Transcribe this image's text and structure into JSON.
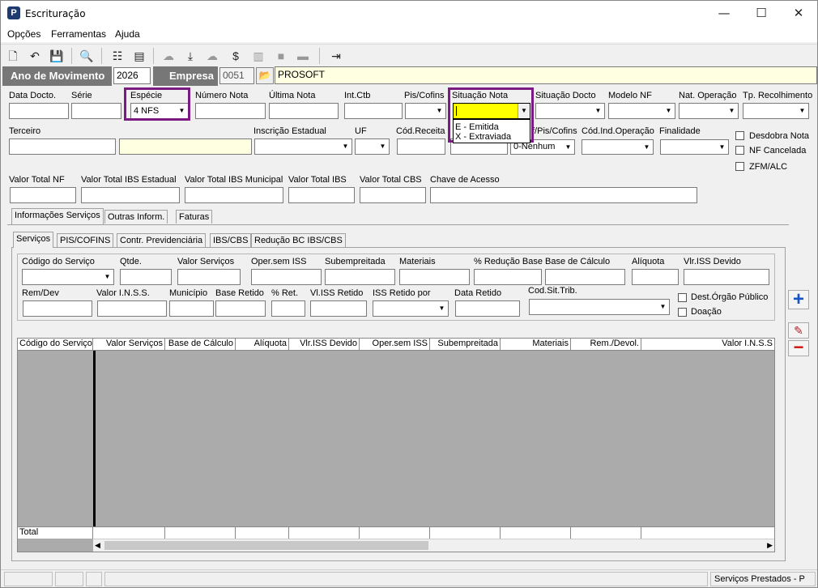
{
  "window": {
    "title": "Escrituração",
    "min": "—",
    "max": "☐",
    "close": "✕"
  },
  "menu": [
    "Opções",
    "Ferramentas",
    "Ajuda"
  ],
  "header": {
    "ano_label": "Ano de Movimento",
    "ano_value": "2026",
    "empresa_label": "Empresa",
    "empresa_code": "0051",
    "empresa_name": "PROSOFT"
  },
  "labels": {
    "data_docto": "Data Docto.",
    "serie": "Série",
    "especie": "Espécie",
    "numero_nota": "Número Nota",
    "ultima_nota": "Última Nota",
    "int_ctb": "Int.Ctb",
    "pis_cofins": "Pis/Cofins",
    "situacao_nota": "Situação Nota",
    "situacao_docto": "Situação Docto",
    "modelo_nf": "Modelo NF",
    "nat_operacao": "Nat. Operação",
    "tp_recolhimento": "Tp. Recolhimento",
    "terceiro": "Terceiro",
    "inscricao_estadual": "Inscrição Estadual",
    "uf": "UF",
    "cod_receita": "Cód.Receita",
    "cf_pis_cofins": "f/Pis/Cofins",
    "cod_ind_operacao": "Cód.Ind.Operação",
    "finalidade": "Finalidade",
    "valor_total_nf": "Valor Total NF",
    "valor_ibs_estadual": "Valor Total IBS Estadual",
    "valor_ibs_municipal": "Valor Total IBS Municipal",
    "valor_ibs": "Valor Total IBS",
    "valor_cbs": "Valor Total CBS",
    "chave_acesso": "Chave de Acesso"
  },
  "values": {
    "especie": "4 NFS",
    "situacao_nota": "",
    "cf_pis_cofins": "0-Nenhum"
  },
  "situacao_options": [
    "E - Emitida",
    "X - Extraviada"
  ],
  "checkboxes": {
    "desdobra": "Desdobra Nota",
    "nf_cancelada": "NF Cancelada",
    "zfm": "ZFM/ALC"
  },
  "tabs_top": [
    "Informações Serviços",
    "Outras Inform.",
    "Faturas"
  ],
  "tabs_sub": [
    "Serviços",
    "PIS/COFINS",
    "Contr. Previdenciária",
    "IBS/CBS",
    "Redução BC IBS/CBS"
  ],
  "svc_labels": {
    "cod_servico": "Código do Serviço",
    "qtde": "Qtde.",
    "valor_servicos": "Valor Serviços",
    "oper_sem_iss": "Oper.sem ISS",
    "subempreitada": "Subempreitada",
    "materiais": "Materiais",
    "reducao_base": "% Redução Base",
    "base_calculo": "Base de Cálculo",
    "aliquota": "Alíquota",
    "vlr_iss_devido": "Vlr.ISS Devido",
    "rem_dev": "Rem/Dev",
    "valor_inss": "Valor I.N.S.S.",
    "municipio": "Município",
    "base_retido": "Base Retido",
    "perc_ret": "% Ret.",
    "vl_iss_retido": "Vl.ISS Retido",
    "iss_retido_por": "ISS Retido por",
    "data_retido": "Data Retido",
    "cod_sit_trib": "Cod.Sit.Trib.",
    "dest_orgao": "Dest.Órgão Público",
    "doacao": "Doação"
  },
  "grid_headers": [
    "Código do Serviço",
    "Valor Serviços",
    "Base de Cálculo",
    "Alíquota",
    "Vlr.ISS Devido",
    "Oper.sem ISS",
    "Subempreitada",
    "Materiais",
    "Rem./Devol.",
    "Valor I.N.S.S"
  ],
  "grid_total": "Total",
  "status": {
    "right": "Serviços Prestados - P"
  },
  "colors": {
    "highlight": "#7b1a82",
    "yellow_field": "#ffff00",
    "header_gray": "#777777"
  }
}
